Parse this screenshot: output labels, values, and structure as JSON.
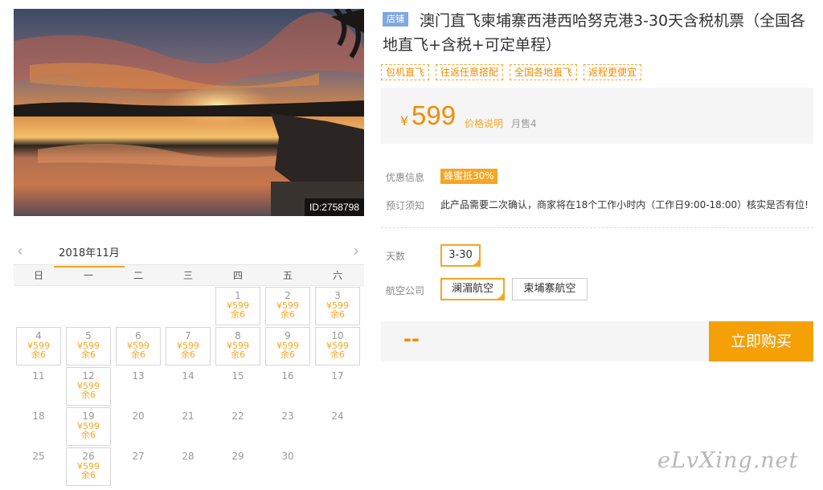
{
  "photo": {
    "id_label": "ID:2758798"
  },
  "calendar": {
    "prev_icon": "chevron-left",
    "next_icon": "chevron-right",
    "month_label": "2018年11月",
    "weekdays": [
      "日",
      "一",
      "二",
      "三",
      "四",
      "五",
      "六"
    ],
    "leading_blanks": 4,
    "days": [
      {
        "d": "1",
        "price": "¥599",
        "remain": "余6"
      },
      {
        "d": "2",
        "price": "¥599",
        "remain": "余6"
      },
      {
        "d": "3",
        "price": "¥599",
        "remain": "余6"
      },
      {
        "d": "4",
        "price": "¥599",
        "remain": "余6"
      },
      {
        "d": "5",
        "price": "¥599",
        "remain": "余6"
      },
      {
        "d": "6",
        "price": "¥599",
        "remain": "余6"
      },
      {
        "d": "7",
        "price": "¥599",
        "remain": "余6"
      },
      {
        "d": "8",
        "price": "¥599",
        "remain": "余6"
      },
      {
        "d": "9",
        "price": "¥599",
        "remain": "余6"
      },
      {
        "d": "10",
        "price": "¥599",
        "remain": "余6"
      },
      {
        "d": "11"
      },
      {
        "d": "12",
        "price": "¥599",
        "remain": "余6"
      },
      {
        "d": "13"
      },
      {
        "d": "14"
      },
      {
        "d": "15"
      },
      {
        "d": "16"
      },
      {
        "d": "17"
      },
      {
        "d": "18"
      },
      {
        "d": "19",
        "price": "¥599",
        "remain": "余6"
      },
      {
        "d": "20"
      },
      {
        "d": "21"
      },
      {
        "d": "22"
      },
      {
        "d": "23"
      },
      {
        "d": "24"
      },
      {
        "d": "25"
      },
      {
        "d": "26",
        "price": "¥599",
        "remain": "余6"
      },
      {
        "d": "27"
      },
      {
        "d": "28"
      },
      {
        "d": "29"
      },
      {
        "d": "30"
      }
    ]
  },
  "product": {
    "shop_tag": "店铺",
    "title": "澳门直飞柬埔寨西港西哈努克港3-30天含税机票（全国各地直飞+含税+可定单程）",
    "tags": [
      "包机直飞",
      "往返任意搭配",
      "全国各地直飞",
      "返程更便宜"
    ],
    "currency": "¥",
    "price": "599",
    "price_note": "价格说明",
    "monthly_sales": "月售4",
    "promo_label": "优惠信息",
    "promo_badge": "蜂蜜抵30%",
    "notice_label": "预订须知",
    "notice_text": "此产品需要二次确认，商家将在18个工作小时内（工作日9:00-18:00）核实是否有位!",
    "days_label": "天数",
    "days_option": "3-30",
    "airline_label": "航空公司",
    "airline_options": [
      "澜湄航空",
      "柬埔寨航空"
    ],
    "total_placeholder": "--",
    "buy_button": "立即购买"
  },
  "watermark": "eLvXing.net",
  "colors": {
    "accent": "#f5a623",
    "price": "#f08c00",
    "shop_tag": "#7fa9e0"
  }
}
